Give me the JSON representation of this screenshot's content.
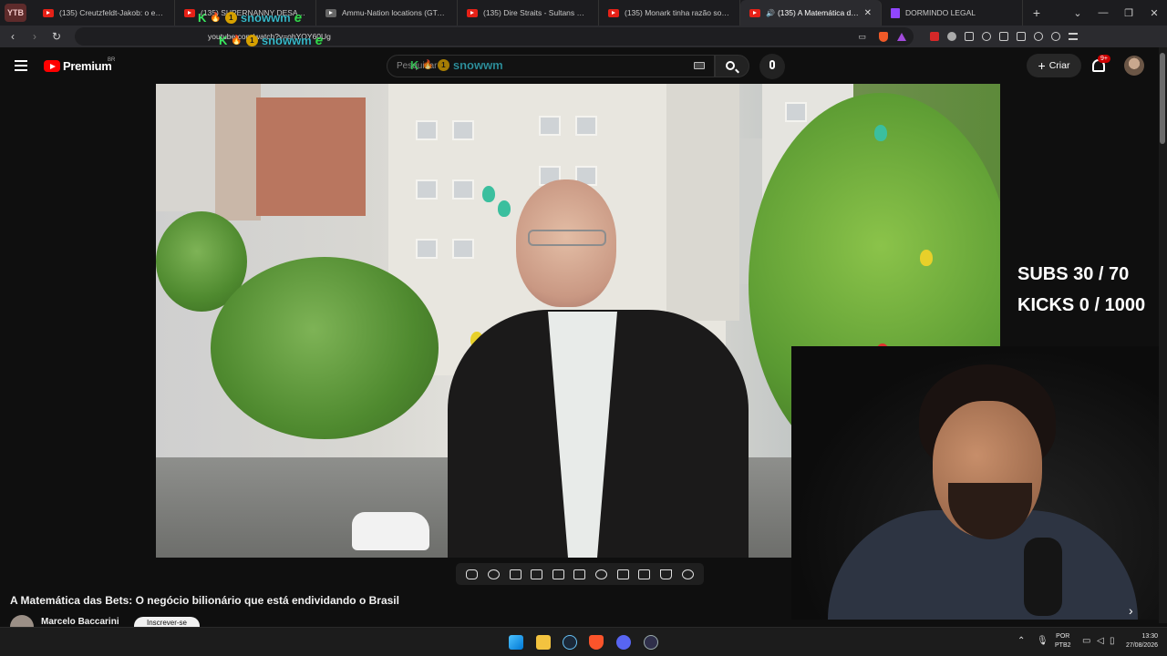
{
  "browser": {
    "tab_group_label": "YTB",
    "tabs": [
      {
        "title": "(135) Creutzfeldt-Jakob: o estranh"
      },
      {
        "title": "(135) SUPERNANNY DESABAFA so"
      },
      {
        "title": "Ammu-Nation locations (GTA III) -"
      },
      {
        "title": "(135) Dire Straits - Sultans Of Swin"
      },
      {
        "title": "(135) Monark tinha razão sobre o"
      },
      {
        "title": "(135) A Matemática das Bets"
      },
      {
        "title": "DORMINDO LEGAL"
      }
    ],
    "active_tab": 5,
    "url": "youtube.com/watch?v=ohYOY60Ug"
  },
  "youtube": {
    "brand": "Premium",
    "region": "BR",
    "search_placeholder": "Pesquisar",
    "create_label": "Criar",
    "notification_count": "9+"
  },
  "overlay": {
    "username": "snowwm",
    "rank": "1",
    "letter_k": "K",
    "letter_e": "e"
  },
  "stream_goals": {
    "subs_line": "SUBS 30 / 70",
    "kicks_line": "KICKS 0 / 1000"
  },
  "video": {
    "title": "A Matemática das Bets: O negócio bilionário que está endividando o Brasil",
    "channel": "Marcelo Baccarini",
    "subscribe_label": "Inscrever-se"
  },
  "taskbar": {
    "lang_line1": "POR",
    "lang_line2": "PTB2",
    "time": "13:30",
    "date": "27/08/2026"
  },
  "colors": {
    "accent_red": "#ff0000",
    "overlay_green": "#39e75f",
    "overlay_cyan": "#3ec8d8"
  }
}
